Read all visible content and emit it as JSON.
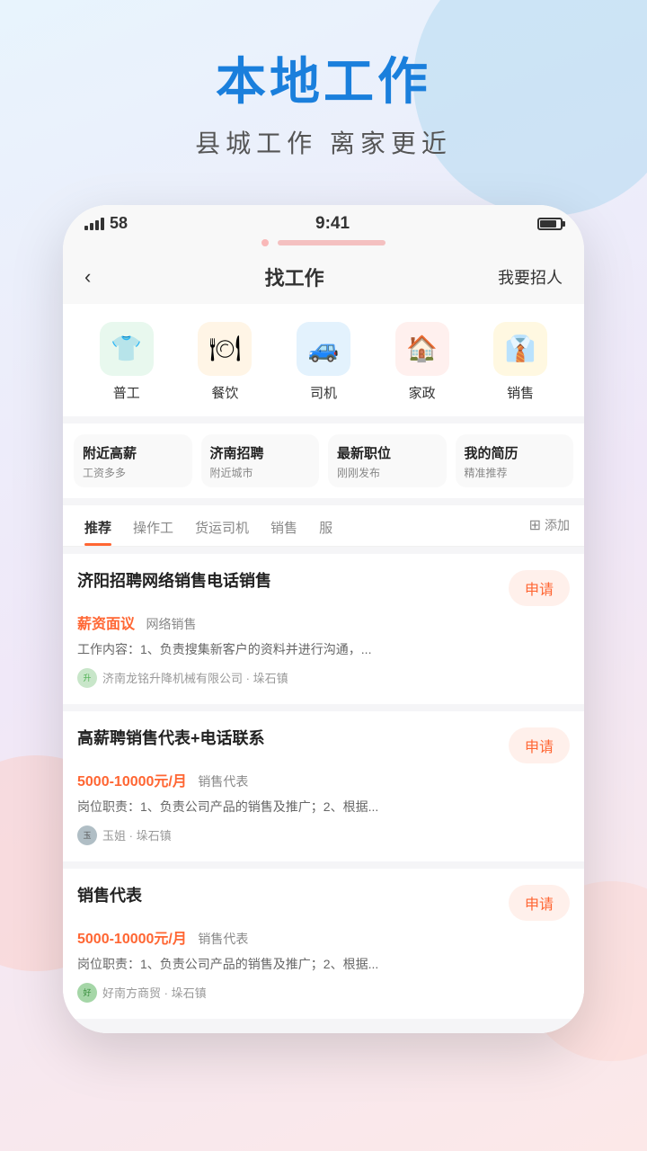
{
  "background": {
    "blobColors": [
      "#b8d9f0",
      "#ffc8c0",
      "#ffd0c8"
    ]
  },
  "header": {
    "title": "本地工作",
    "subtitle": "县城工作  离家更近"
  },
  "phone": {
    "statusBar": {
      "signal": "58",
      "time": "9:41"
    },
    "navBar": {
      "back": "‹",
      "title": "找工作",
      "action": "我要招人"
    },
    "categories": [
      {
        "id": "general-worker",
        "label": "普工",
        "icon": "👕",
        "color": "#4caf7d",
        "bg": "#e8f8ee"
      },
      {
        "id": "food-service",
        "label": "餐饮",
        "icon": "🍽",
        "color": "#f5a623",
        "bg": "#fff5e6"
      },
      {
        "id": "driver",
        "label": "司机",
        "icon": "🚗",
        "color": "#2196f3",
        "bg": "#e3f2fd"
      },
      {
        "id": "housekeeping",
        "label": "家政",
        "icon": "🏠",
        "color": "#f44336",
        "bg": "#fff0ee"
      },
      {
        "id": "sales",
        "label": "销售",
        "icon": "💼",
        "color": "#ff9800",
        "bg": "#fff8e1"
      }
    ],
    "quickAccess": [
      {
        "id": "nearby-high-salary",
        "title": "附近高薪",
        "subtitle": "工资多多"
      },
      {
        "id": "jinan-recruit",
        "title": "济南招聘",
        "subtitle": "附近城市"
      },
      {
        "id": "latest-jobs",
        "title": "最新职位",
        "subtitle": "刚刚发布"
      },
      {
        "id": "my-resume",
        "title": "我的简历",
        "subtitle": "精准推荐"
      }
    ],
    "tabs": [
      {
        "id": "recommended",
        "label": "推荐",
        "active": true
      },
      {
        "id": "operator",
        "label": "操作工",
        "active": false
      },
      {
        "id": "freight-driver",
        "label": "货运司机",
        "active": false
      },
      {
        "id": "sales-tab",
        "label": "销售",
        "active": false
      },
      {
        "id": "more",
        "label": "服",
        "active": false
      },
      {
        "id": "add",
        "label": "添加",
        "active": false
      }
    ],
    "jobs": [
      {
        "id": "job-1",
        "title": "济阳招聘网络销售电话销售",
        "salary": "薪资面议",
        "salaryType": "negotiable",
        "tag": "网络销售",
        "desc": "工作内容：1、负责搜集新客户的资料并进行沟通，...",
        "company": "济南龙铭升降机械有限公司",
        "location": "垛石镇",
        "hasAvatar": false,
        "applyLabel": "申请"
      },
      {
        "id": "job-2",
        "title": "高薪聘销售代表+电话联系",
        "salary": "5000-10000元/月",
        "salaryType": "range",
        "tag": "销售代表",
        "desc": "岗位职责：1、负责公司产品的销售及推广；2、根据...",
        "company": "玉姐",
        "location": "垛石镇",
        "hasAvatar": true,
        "applyLabel": "申请"
      },
      {
        "id": "job-3",
        "title": "销售代表",
        "salary": "5000-10000元/月",
        "salaryType": "range",
        "tag": "销售代表",
        "desc": "岗位职责：1、负责公司产品的销售及推广；2、根据...",
        "company": "好南方商贸",
        "location": "垛石镇",
        "hasAvatar": true,
        "applyLabel": "申请"
      }
    ]
  }
}
